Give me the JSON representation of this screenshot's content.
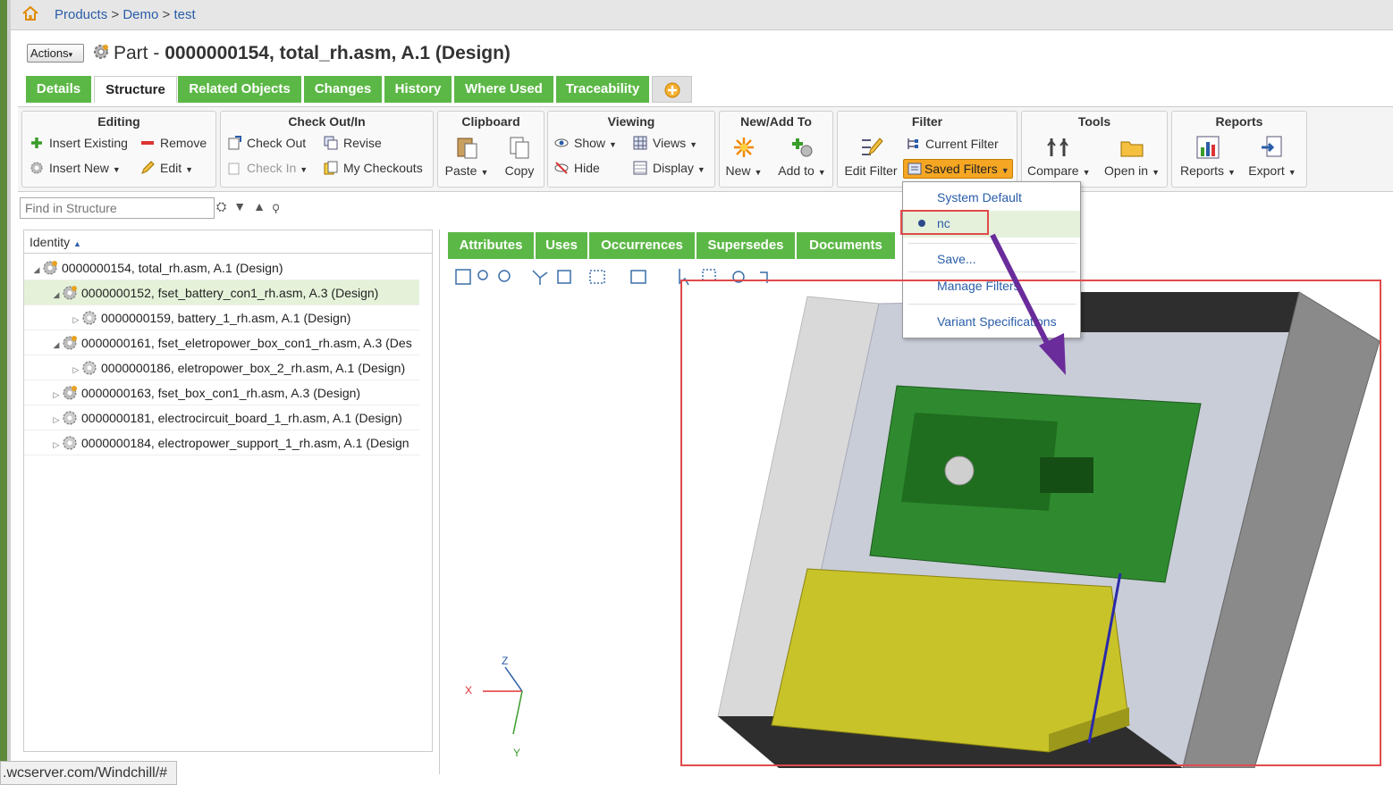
{
  "breadcrumb": {
    "products": "Products",
    "sep": ">",
    "demo": "Demo",
    "test": "test"
  },
  "header": {
    "actions": "Actions",
    "part_prefix": "Part -",
    "part_title": "0000000154, total_rh.asm, A.1 (Design)"
  },
  "tabs": [
    "Details",
    "Structure",
    "Related Objects",
    "Changes",
    "History",
    "Where Used",
    "Traceability"
  ],
  "ribbon": {
    "editing": {
      "title": "Editing",
      "insert_existing": "Insert Existing",
      "remove": "Remove",
      "insert_new": "Insert New",
      "edit": "Edit"
    },
    "checkout": {
      "title": "Check Out/In",
      "check_out": "Check Out",
      "revise": "Revise",
      "check_in": "Check In",
      "my_checkouts": "My Checkouts"
    },
    "clipboard": {
      "title": "Clipboard",
      "paste": "Paste",
      "copy": "Copy"
    },
    "viewing": {
      "title": "Viewing",
      "show": "Show",
      "views": "Views",
      "hide": "Hide",
      "display": "Display"
    },
    "newadd": {
      "title": "New/Add To",
      "new": "New",
      "add_to": "Add to"
    },
    "filter": {
      "title": "Filter",
      "edit_filter": "Edit Filter",
      "current_filter": "Current Filter",
      "saved_filters": "Saved Filters"
    },
    "tools": {
      "title": "Tools",
      "compare": "Compare",
      "open_in": "Open in"
    },
    "reports": {
      "title": "Reports",
      "reports": "Reports",
      "export": "Export"
    }
  },
  "find": {
    "placeholder": "Find in Structure"
  },
  "tree": {
    "header": "Identity",
    "rows": [
      "0000000154, total_rh.asm, A.1 (Design)",
      "0000000152, fset_battery_con1_rh.asm, A.3 (Design)",
      "0000000159, battery_1_rh.asm, A.1 (Design)",
      "0000000161, fset_eletropower_box_con1_rh.asm, A.3 (Des",
      "0000000186, eletropower_box_2_rh.asm, A.1 (Design)",
      "0000000163, fset_box_con1_rh.asm, A.3 (Design)",
      "0000000181, electrocircuit_board_1_rh.asm, A.1 (Design)",
      "0000000184, electropower_support_1_rh.asm, A.1 (Design"
    ]
  },
  "right_tabs": [
    "Attributes",
    "Uses",
    "Occurrences",
    "Supersedes",
    "Documents"
  ],
  "dropdown": {
    "system_default": "System Default",
    "nc": "nc",
    "save": "Save...",
    "manage": "Manage Filters",
    "variant": "Variant Specifications"
  },
  "axes": {
    "z": "Z",
    "x": "X",
    "y": "Y"
  },
  "status": ".wcserver.com/Windchill/#",
  "colors": {
    "tab_green": "#5cb846",
    "highlight_red": "#e04a4a",
    "arrow_purple": "#6a2c9a",
    "saved_filter_orange": "#f5a623"
  }
}
